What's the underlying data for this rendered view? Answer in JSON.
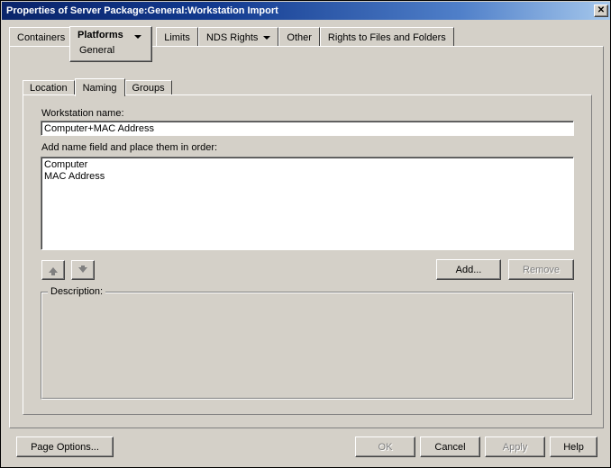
{
  "window": {
    "title": "Properties of Server Package:General:Workstation Import",
    "close_icon": "close-icon",
    "close_glyph": "✕",
    "colors": {
      "face": "#d4d0c8",
      "title_left": "#0a246a",
      "title_right": "#a6c8ec",
      "field_bg": "#ffffff",
      "disabled_text": "#808080"
    }
  },
  "outer_tabs": [
    {
      "label": "Containers",
      "active": false,
      "has_dropdown": false
    },
    {
      "label": "Platforms",
      "active": true,
      "has_dropdown": true,
      "submenu_selected": "General"
    },
    {
      "label": "Limits",
      "active": false,
      "has_dropdown": false
    },
    {
      "label": "NDS Rights",
      "active": false,
      "has_dropdown": true
    },
    {
      "label": "Other",
      "active": false,
      "has_dropdown": false
    },
    {
      "label": "Rights to Files and Folders",
      "active": false,
      "has_dropdown": false
    }
  ],
  "inner_tabs": [
    {
      "label": "Location",
      "active": false
    },
    {
      "label": "Naming",
      "active": true
    },
    {
      "label": "Groups",
      "active": false
    }
  ],
  "form": {
    "workstation_name_label": "Workstation name:",
    "workstation_name_value": "Computer+MAC Address",
    "add_name_field_label": "Add name field and place them in order:",
    "name_fields": [
      "Computer",
      "MAC Address"
    ],
    "move_up_icon": "arrow-up-icon",
    "move_down_icon": "arrow-down-icon",
    "add_button": "Add...",
    "remove_button": "Remove",
    "remove_enabled": false,
    "add_enabled": true,
    "description_legend": "Description:",
    "description_value": ""
  },
  "bottom_bar": {
    "page_options": "Page Options...",
    "ok": "OK",
    "cancel": "Cancel",
    "apply": "Apply",
    "help": "Help",
    "enabled": {
      "page_options": true,
      "ok": false,
      "cancel": true,
      "apply": false,
      "help": true
    }
  }
}
